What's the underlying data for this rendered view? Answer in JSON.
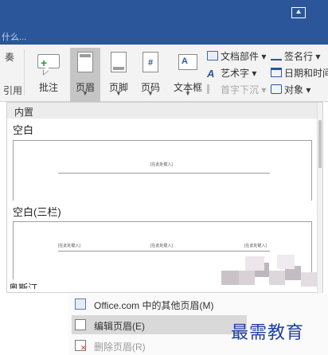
{
  "titlebar": {
    "restore_icon": "ribbon-display-options-icon",
    "accent": "#2b579a"
  },
  "tellme": {
    "placeholder": "什么..."
  },
  "ribbon": {
    "partial_top": "奏",
    "partial_bottom": "引用",
    "comment_label": "批注",
    "header_label": "页眉",
    "footer_label": "页脚",
    "pagenum_label": "页码",
    "textbox_label": "文本框",
    "quickparts": "文档部件",
    "wordart": "艺术字",
    "dropcap": "首字下沉",
    "signature": "签名行",
    "datetime": "日期和时间",
    "object": "对象"
  },
  "gallery": {
    "header": "内置",
    "blank_title": "空白",
    "blank_placeholder": "[在此处键入]",
    "three_col_title": "空白(三栏)",
    "three_col_placeholders": [
      "[在此处键入]",
      "[在此处键入]",
      "[在此处键入]"
    ],
    "next_title": "奥斯汀"
  },
  "menu": {
    "items": [
      {
        "label": "Office.com 中的其他页眉(M)",
        "icon": "office-web-icon"
      },
      {
        "label": "编辑页眉(E)",
        "icon": "edit-header-icon"
      },
      {
        "label": "删除页眉(R)",
        "icon": "delete-header-icon"
      }
    ]
  },
  "watermark": "最需教育"
}
